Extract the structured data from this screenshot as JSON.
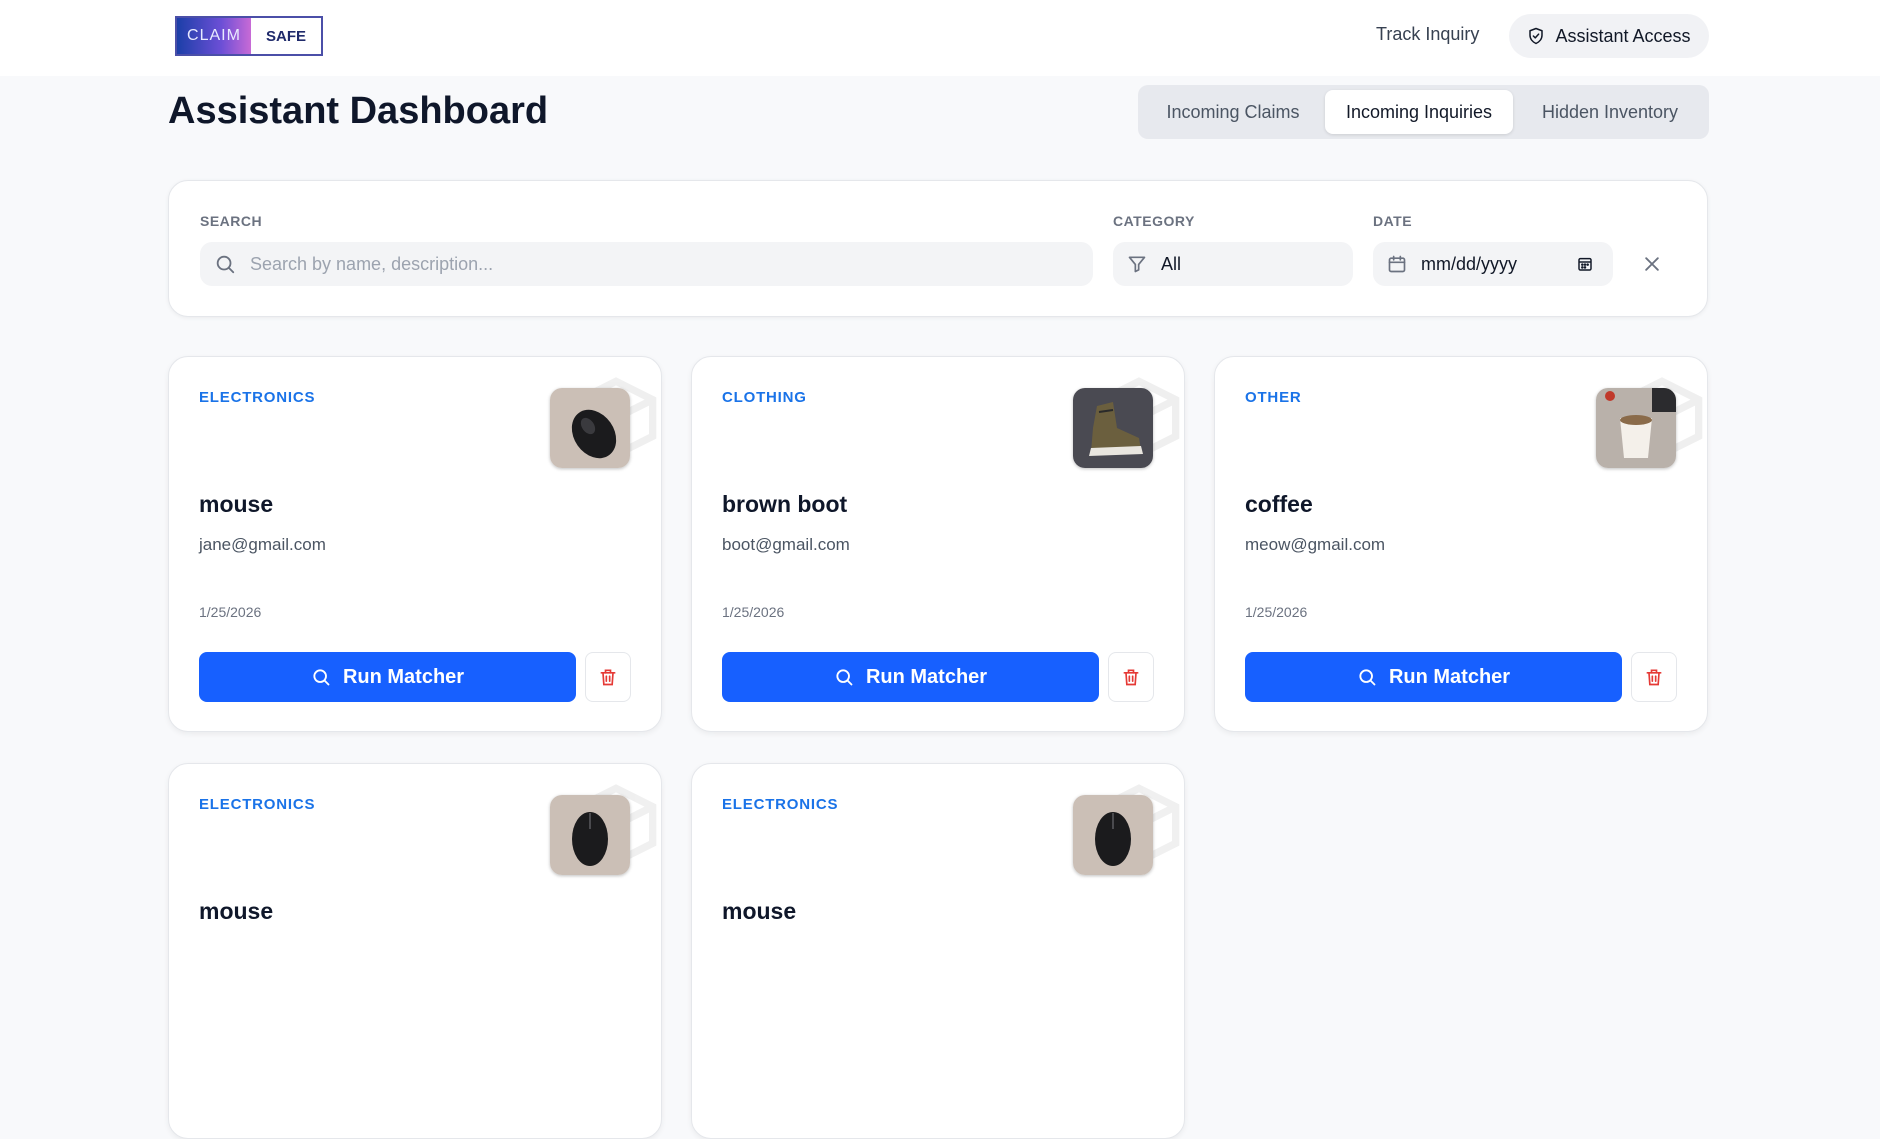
{
  "header": {
    "logo_left": "CLAIM",
    "logo_right": "SAFE",
    "track_label": "Track Inquiry",
    "assistant_label": "Assistant Access"
  },
  "page": {
    "title": "Assistant Dashboard",
    "tabs": [
      {
        "label": "Incoming Claims",
        "active": false
      },
      {
        "label": "Incoming Inquiries",
        "active": true
      },
      {
        "label": "Hidden Inventory",
        "active": false
      }
    ]
  },
  "filters": {
    "search_label": "SEARCH",
    "search_placeholder": "Search by name, description...",
    "category_label": "CATEGORY",
    "category_value": "All",
    "date_label": "DATE",
    "date_value": "mm/dd/yyyy"
  },
  "cards": [
    {
      "category": "ELECTRONICS",
      "title": "mouse",
      "email": "jane@gmail.com",
      "date": "1/25/2026",
      "action": "Run Matcher"
    },
    {
      "category": "CLOTHING",
      "title": "brown boot",
      "email": "boot@gmail.com",
      "date": "1/25/2026",
      "action": "Run Matcher"
    },
    {
      "category": "OTHER",
      "title": "coffee",
      "email": "meow@gmail.com",
      "date": "1/25/2026",
      "action": "Run Matcher"
    },
    {
      "category": "ELECTRONICS",
      "title": "mouse"
    },
    {
      "category": "ELECTRONICS",
      "title": "mouse"
    }
  ],
  "colors": {
    "primary": "#1760ff",
    "category": "#1a73e8",
    "delete": "#e53935"
  }
}
